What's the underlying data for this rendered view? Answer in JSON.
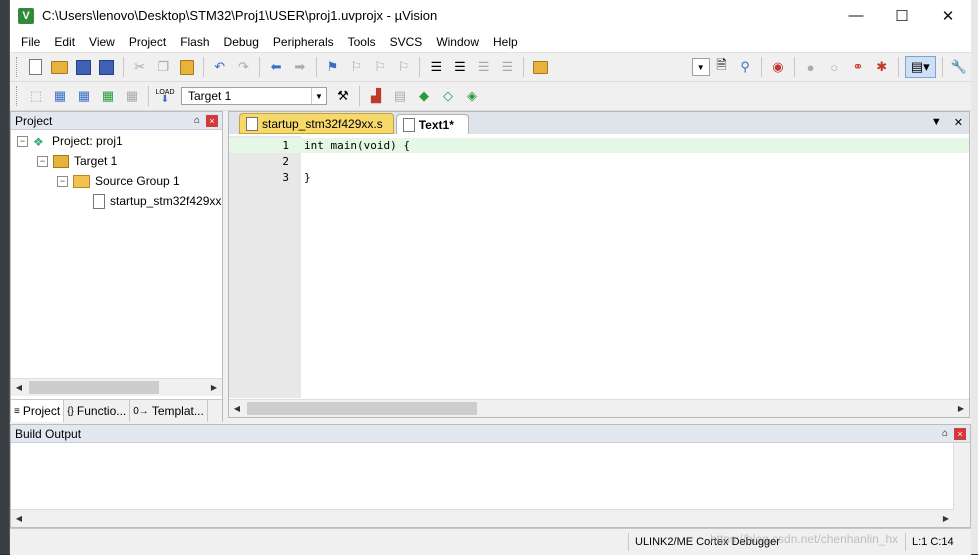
{
  "window": {
    "title": "C:\\Users\\lenovo\\Desktop\\STM32\\Proj1\\USER\\proj1.uvprojx - µVision",
    "app_icon": "V",
    "controls": {
      "minimize": "—",
      "maximize": "☐",
      "close": "✕"
    }
  },
  "menubar": [
    "File",
    "Edit",
    "View",
    "Project",
    "Flash",
    "Debug",
    "Peripherals",
    "Tools",
    "SVCS",
    "Window",
    "Help"
  ],
  "toolbar2": {
    "target": "Target 1",
    "load_label": "LOAD"
  },
  "project_panel": {
    "title": "Project",
    "pin": "⌂",
    "close": "×",
    "tree": {
      "project": "Project: proj1",
      "target": "Target 1",
      "group": "Source Group 1",
      "file": "startup_stm32f429xx"
    },
    "tabs": [
      {
        "icon": "≡",
        "label": "Project"
      },
      {
        "icon": "{}",
        "label": "Functio..."
      },
      {
        "icon": "0→",
        "label": "Templat..."
      }
    ]
  },
  "editor": {
    "tabs": [
      {
        "label": "startup_stm32f429xx.s",
        "active": false
      },
      {
        "label": "Text1*",
        "active": true
      }
    ],
    "lines": [
      {
        "num": "1",
        "text": "int main(void) {"
      },
      {
        "num": "2",
        "text": ""
      },
      {
        "num": "3",
        "text": "}"
      }
    ]
  },
  "build_output": {
    "title": "Build Output",
    "pin": "⌂",
    "close": "×"
  },
  "statusbar": {
    "debugger": "ULINK2/ME Cortex Debugger",
    "position": "L:1 C:14",
    "watermark": "https://blog.csdn.net/chenhanlin_hx"
  },
  "colors": {
    "current_line": "#e5f8e5",
    "tab_inactive": "#f6d96a",
    "panel_header": "#e3e8f0"
  }
}
